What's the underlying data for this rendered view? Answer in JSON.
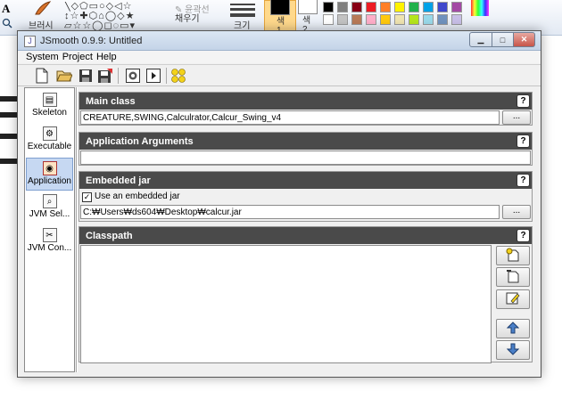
{
  "background_app": {
    "ribbon": {
      "brush_label": "브러시",
      "fill_label": "채우기",
      "size_label": "크기",
      "color1_label": "색\n1",
      "color2_label": "색\n2"
    },
    "swatches": [
      "#000000",
      "#7f7f7f",
      "#880015",
      "#ed1c24",
      "#ff7f27",
      "#fff200",
      "#22b14c",
      "#00a2e8",
      "#3f48cc",
      "#a349a4",
      "#ffffff",
      "#c3c3c3",
      "#b97a57",
      "#ffaec9",
      "#ffc90e",
      "#efe4b0",
      "#b5e61d",
      "#99d9ea",
      "#7092be",
      "#c8bfe7"
    ]
  },
  "window": {
    "title": "JSmooth 0.9.9: Untitled",
    "icon": "jsmooth-app-icon",
    "controls": {
      "minimize": "▁",
      "maximize": "□",
      "close": "✕"
    },
    "menu": [
      "System",
      "Project",
      "Help"
    ],
    "toolbar": [
      {
        "name": "new-file-icon"
      },
      {
        "name": "open-folder-icon"
      },
      {
        "name": "save-icon"
      },
      {
        "name": "save-as-icon"
      },
      {
        "name": "compile-icon"
      },
      {
        "name": "run-icon"
      },
      {
        "name": "about-icon"
      }
    ],
    "sidebar": [
      {
        "label": "Skeleton",
        "icon": "skeleton-icon",
        "active": false
      },
      {
        "label": "Executable",
        "icon": "executable-icon",
        "active": false
      },
      {
        "label": "Application",
        "icon": "application-icon",
        "active": true
      },
      {
        "label": "JVM Sel...",
        "icon": "jvm-selection-icon",
        "active": false
      },
      {
        "label": "JVM Con...",
        "icon": "jvm-configuration-icon",
        "active": false
      }
    ],
    "panels": {
      "main_class": {
        "title": "Main class",
        "help": "?",
        "value": "CREATURE,SWING,Calculrator,Calcur_Swing_v4",
        "browse": "..."
      },
      "app_args": {
        "title": "Application Arguments",
        "help": "?",
        "value": ""
      },
      "embedded_jar": {
        "title": "Embedded jar",
        "help": "?",
        "checkbox_label": "Use an embedded jar",
        "checked": true,
        "path": "C:₩Users₩ds604₩Desktop₩calcur.jar",
        "browse": "..."
      },
      "classpath": {
        "title": "Classpath",
        "help": "?",
        "buttons": [
          "add-jar-icon",
          "add-folder-icon",
          "edit-icon",
          "move-up-icon",
          "move-down-icon"
        ]
      }
    }
  }
}
